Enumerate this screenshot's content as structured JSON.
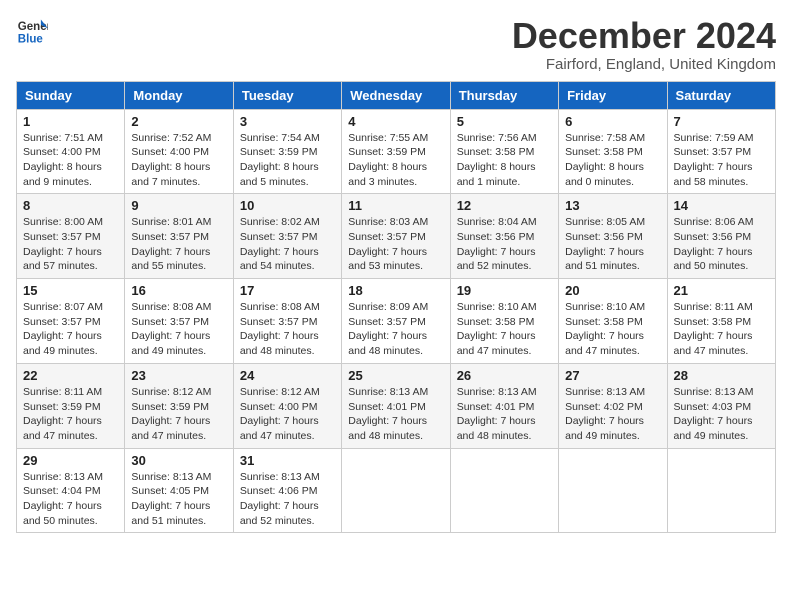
{
  "logo": {
    "line1": "General",
    "line2": "Blue"
  },
  "title": "December 2024",
  "location": "Fairford, England, United Kingdom",
  "days_of_week": [
    "Sunday",
    "Monday",
    "Tuesday",
    "Wednesday",
    "Thursday",
    "Friday",
    "Saturday"
  ],
  "weeks": [
    [
      {
        "day": "1",
        "sunrise": "Sunrise: 7:51 AM",
        "sunset": "Sunset: 4:00 PM",
        "daylight": "Daylight: 8 hours and 9 minutes."
      },
      {
        "day": "2",
        "sunrise": "Sunrise: 7:52 AM",
        "sunset": "Sunset: 4:00 PM",
        "daylight": "Daylight: 8 hours and 7 minutes."
      },
      {
        "day": "3",
        "sunrise": "Sunrise: 7:54 AM",
        "sunset": "Sunset: 3:59 PM",
        "daylight": "Daylight: 8 hours and 5 minutes."
      },
      {
        "day": "4",
        "sunrise": "Sunrise: 7:55 AM",
        "sunset": "Sunset: 3:59 PM",
        "daylight": "Daylight: 8 hours and 3 minutes."
      },
      {
        "day": "5",
        "sunrise": "Sunrise: 7:56 AM",
        "sunset": "Sunset: 3:58 PM",
        "daylight": "Daylight: 8 hours and 1 minute."
      },
      {
        "day": "6",
        "sunrise": "Sunrise: 7:58 AM",
        "sunset": "Sunset: 3:58 PM",
        "daylight": "Daylight: 8 hours and 0 minutes."
      },
      {
        "day": "7",
        "sunrise": "Sunrise: 7:59 AM",
        "sunset": "Sunset: 3:57 PM",
        "daylight": "Daylight: 7 hours and 58 minutes."
      }
    ],
    [
      {
        "day": "8",
        "sunrise": "Sunrise: 8:00 AM",
        "sunset": "Sunset: 3:57 PM",
        "daylight": "Daylight: 7 hours and 57 minutes."
      },
      {
        "day": "9",
        "sunrise": "Sunrise: 8:01 AM",
        "sunset": "Sunset: 3:57 PM",
        "daylight": "Daylight: 7 hours and 55 minutes."
      },
      {
        "day": "10",
        "sunrise": "Sunrise: 8:02 AM",
        "sunset": "Sunset: 3:57 PM",
        "daylight": "Daylight: 7 hours and 54 minutes."
      },
      {
        "day": "11",
        "sunrise": "Sunrise: 8:03 AM",
        "sunset": "Sunset: 3:57 PM",
        "daylight": "Daylight: 7 hours and 53 minutes."
      },
      {
        "day": "12",
        "sunrise": "Sunrise: 8:04 AM",
        "sunset": "Sunset: 3:56 PM",
        "daylight": "Daylight: 7 hours and 52 minutes."
      },
      {
        "day": "13",
        "sunrise": "Sunrise: 8:05 AM",
        "sunset": "Sunset: 3:56 PM",
        "daylight": "Daylight: 7 hours and 51 minutes."
      },
      {
        "day": "14",
        "sunrise": "Sunrise: 8:06 AM",
        "sunset": "Sunset: 3:56 PM",
        "daylight": "Daylight: 7 hours and 50 minutes."
      }
    ],
    [
      {
        "day": "15",
        "sunrise": "Sunrise: 8:07 AM",
        "sunset": "Sunset: 3:57 PM",
        "daylight": "Daylight: 7 hours and 49 minutes."
      },
      {
        "day": "16",
        "sunrise": "Sunrise: 8:08 AM",
        "sunset": "Sunset: 3:57 PM",
        "daylight": "Daylight: 7 hours and 49 minutes."
      },
      {
        "day": "17",
        "sunrise": "Sunrise: 8:08 AM",
        "sunset": "Sunset: 3:57 PM",
        "daylight": "Daylight: 7 hours and 48 minutes."
      },
      {
        "day": "18",
        "sunrise": "Sunrise: 8:09 AM",
        "sunset": "Sunset: 3:57 PM",
        "daylight": "Daylight: 7 hours and 48 minutes."
      },
      {
        "day": "19",
        "sunrise": "Sunrise: 8:10 AM",
        "sunset": "Sunset: 3:58 PM",
        "daylight": "Daylight: 7 hours and 47 minutes."
      },
      {
        "day": "20",
        "sunrise": "Sunrise: 8:10 AM",
        "sunset": "Sunset: 3:58 PM",
        "daylight": "Daylight: 7 hours and 47 minutes."
      },
      {
        "day": "21",
        "sunrise": "Sunrise: 8:11 AM",
        "sunset": "Sunset: 3:58 PM",
        "daylight": "Daylight: 7 hours and 47 minutes."
      }
    ],
    [
      {
        "day": "22",
        "sunrise": "Sunrise: 8:11 AM",
        "sunset": "Sunset: 3:59 PM",
        "daylight": "Daylight: 7 hours and 47 minutes."
      },
      {
        "day": "23",
        "sunrise": "Sunrise: 8:12 AM",
        "sunset": "Sunset: 3:59 PM",
        "daylight": "Daylight: 7 hours and 47 minutes."
      },
      {
        "day": "24",
        "sunrise": "Sunrise: 8:12 AM",
        "sunset": "Sunset: 4:00 PM",
        "daylight": "Daylight: 7 hours and 47 minutes."
      },
      {
        "day": "25",
        "sunrise": "Sunrise: 8:13 AM",
        "sunset": "Sunset: 4:01 PM",
        "daylight": "Daylight: 7 hours and 48 minutes."
      },
      {
        "day": "26",
        "sunrise": "Sunrise: 8:13 AM",
        "sunset": "Sunset: 4:01 PM",
        "daylight": "Daylight: 7 hours and 48 minutes."
      },
      {
        "day": "27",
        "sunrise": "Sunrise: 8:13 AM",
        "sunset": "Sunset: 4:02 PM",
        "daylight": "Daylight: 7 hours and 49 minutes."
      },
      {
        "day": "28",
        "sunrise": "Sunrise: 8:13 AM",
        "sunset": "Sunset: 4:03 PM",
        "daylight": "Daylight: 7 hours and 49 minutes."
      }
    ],
    [
      {
        "day": "29",
        "sunrise": "Sunrise: 8:13 AM",
        "sunset": "Sunset: 4:04 PM",
        "daylight": "Daylight: 7 hours and 50 minutes."
      },
      {
        "day": "30",
        "sunrise": "Sunrise: 8:13 AM",
        "sunset": "Sunset: 4:05 PM",
        "daylight": "Daylight: 7 hours and 51 minutes."
      },
      {
        "day": "31",
        "sunrise": "Sunrise: 8:13 AM",
        "sunset": "Sunset: 4:06 PM",
        "daylight": "Daylight: 7 hours and 52 minutes."
      },
      null,
      null,
      null,
      null
    ]
  ]
}
